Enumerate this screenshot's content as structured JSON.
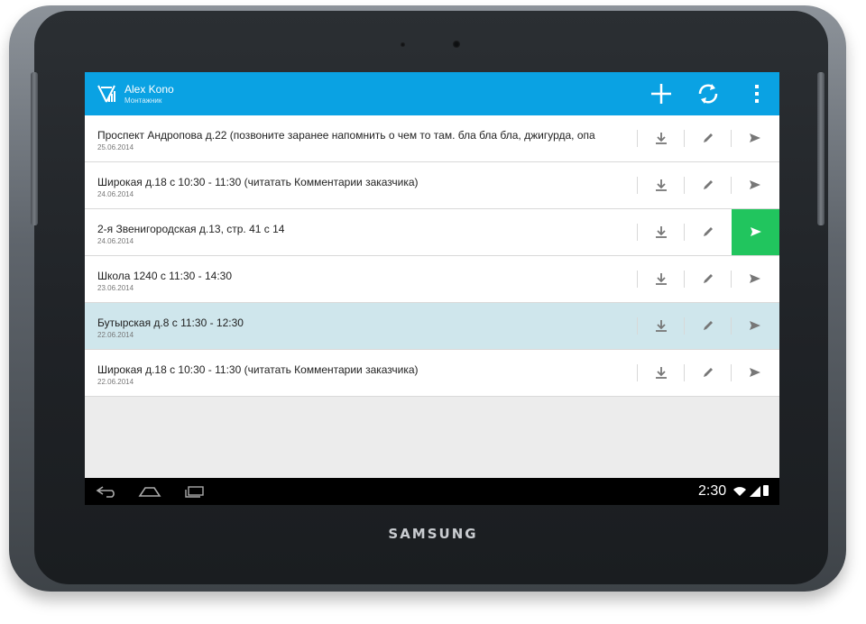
{
  "device": {
    "brand": "SAMSUNG"
  },
  "header": {
    "user_name": "Alex Kono",
    "user_role": "Монтажник",
    "accent_color": "#0aa2e3"
  },
  "actions": {
    "add_icon": "plus-icon",
    "sync_icon": "sync-icon",
    "menu_icon": "more-vert-icon"
  },
  "orders": [
    {
      "title": "Проспект Андропова д.22 (позвоните заранее напомнить о чем то там. бла бла бла, джигурда, опа",
      "date": "25.06.2014"
    },
    {
      "title": "Широкая д.18 с 10:30 - 11:30 (читатать Комментарии заказчика)",
      "date": "24.06.2014"
    },
    {
      "title": "2-я Звенигородская д.13, стр. 41 с 14",
      "date": "24.06.2014"
    },
    {
      "title": "Школа 1240 с 11:30 - 14:30",
      "date": "23.06.2014"
    },
    {
      "title": "Бутырская д.8 с 11:30 - 12:30",
      "date": "22.06.2014"
    },
    {
      "title": "Широкая д.18 с 10:30 - 11:30 (читатать Комментарии заказчика)",
      "date": "22.06.2014"
    }
  ],
  "row_state": {
    "selected_row": 5,
    "send_active_row": 3,
    "send_active_color": "#21c55e",
    "selected_color": "#cfe6ec"
  },
  "status_bar": {
    "time": "2:30"
  }
}
